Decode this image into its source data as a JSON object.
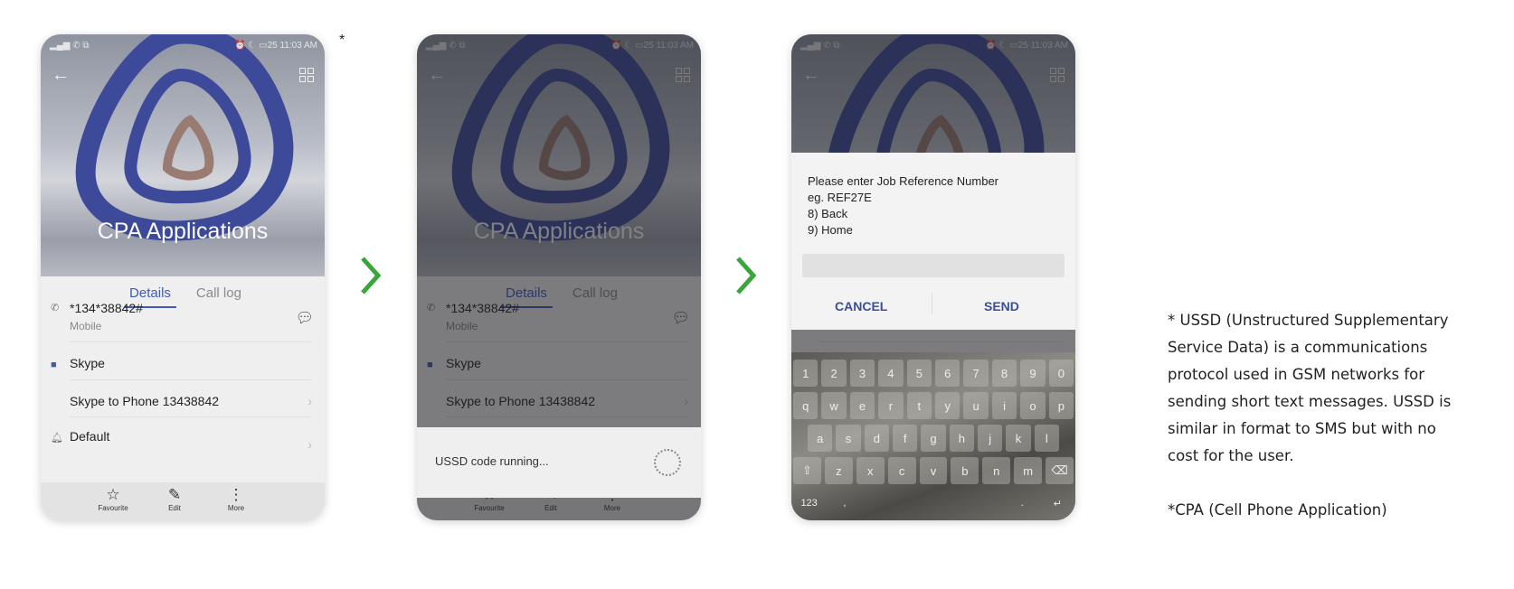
{
  "status": {
    "time": "11:03 AM",
    "battery": "25"
  },
  "contact": {
    "name": "CPA Applications",
    "tabs": [
      "Details",
      "Call log"
    ],
    "number": "*134*38842#",
    "number_type": "Mobile",
    "skype": "Skype",
    "skype_to_phone": "Skype to Phone 13438842",
    "ringtone": "Default"
  },
  "bottom_bar": {
    "favourite": "Favourite",
    "edit": "Edit",
    "more": "More"
  },
  "ussd_running": {
    "text": "USSD code running..."
  },
  "ussd_dialog": {
    "lines": [
      "Please enter Job Reference Number",
      "eg. REF27E",
      "8) Back",
      "9) Home"
    ],
    "input_value": "",
    "cancel": "CANCEL",
    "send": "SEND"
  },
  "keyboard": {
    "rows": [
      [
        "1",
        "2",
        "3",
        "4",
        "5",
        "6",
        "7",
        "8",
        "9",
        "0"
      ],
      [
        "q",
        "w",
        "e",
        "r",
        "t",
        "y",
        "u",
        "i",
        "o",
        "p"
      ],
      [
        "a",
        "s",
        "d",
        "f",
        "g",
        "h",
        "j",
        "k",
        "l"
      ],
      [
        "⇧",
        "z",
        "x",
        "c",
        "v",
        "b",
        "n",
        "m",
        "⌫"
      ],
      [
        "123",
        ",",
        "",
        "",
        "",
        "",
        ".",
        "↵"
      ]
    ]
  },
  "asterisk": "*",
  "notes": {
    "ussd": "* USSD (Unstructured Supplementary Service Data) is a communications protocol used in GSM networks for sending short text messages. USSD is similar in format to SMS but with no cost for the user.",
    "cpa": "*CPA (Cell Phone Application)"
  },
  "colors": {
    "accent": "#3f5bb5",
    "arrow": "#3aa53a",
    "dialog_button": "#3a4f9a"
  }
}
